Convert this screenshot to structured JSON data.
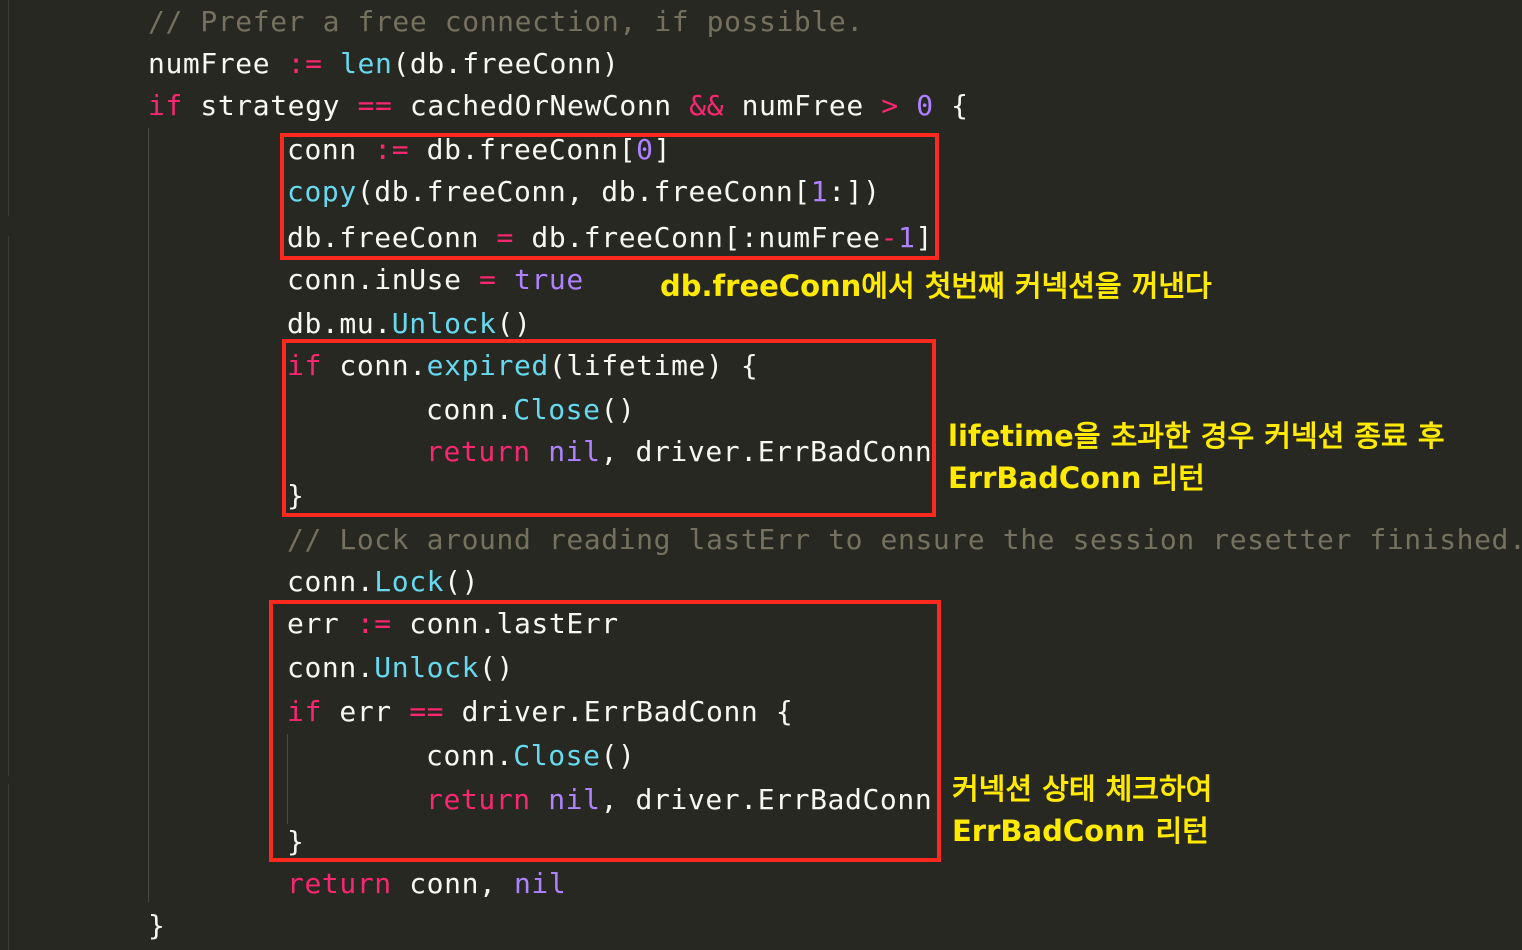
{
  "editor": {
    "lines": [
      [
        {
          "t": "// Prefer a free connection, if possible.",
          "c": "cm"
        }
      ],
      [
        {
          "t": "numFree ",
          "c": "pl"
        },
        {
          "t": ":=",
          "c": "op"
        },
        {
          "t": " ",
          "c": "pl"
        },
        {
          "t": "len",
          "c": "fn"
        },
        {
          "t": "(db.freeConn)",
          "c": "pl"
        }
      ],
      [
        {
          "t": "if",
          "c": "kw"
        },
        {
          "t": " strategy ",
          "c": "pl"
        },
        {
          "t": "==",
          "c": "op"
        },
        {
          "t": " cachedOrNewConn ",
          "c": "pl"
        },
        {
          "t": "&&",
          "c": "op"
        },
        {
          "t": " numFree ",
          "c": "pl"
        },
        {
          "t": ">",
          "c": "op"
        },
        {
          "t": " ",
          "c": "pl"
        },
        {
          "t": "0",
          "c": "nm"
        },
        {
          "t": " {",
          "c": "pl"
        }
      ],
      [
        {
          "t": "conn ",
          "c": "pl"
        },
        {
          "t": ":=",
          "c": "op"
        },
        {
          "t": " db.freeConn[",
          "c": "pl"
        },
        {
          "t": "0",
          "c": "nm"
        },
        {
          "t": "]",
          "c": "pl"
        }
      ],
      [
        {
          "t": "copy",
          "c": "fn"
        },
        {
          "t": "(db.freeConn, db.freeConn[",
          "c": "pl"
        },
        {
          "t": "1",
          "c": "nm"
        },
        {
          "t": ":])",
          "c": "pl"
        }
      ],
      [
        {
          "t": "db.freeConn ",
          "c": "pl"
        },
        {
          "t": "=",
          "c": "op"
        },
        {
          "t": " db.freeConn[:numFree",
          "c": "pl"
        },
        {
          "t": "-",
          "c": "op"
        },
        {
          "t": "1",
          "c": "nm"
        },
        {
          "t": "]",
          "c": "pl"
        }
      ],
      [
        {
          "t": "conn.inUse ",
          "c": "pl"
        },
        {
          "t": "=",
          "c": "op"
        },
        {
          "t": " ",
          "c": "pl"
        },
        {
          "t": "true",
          "c": "nm"
        }
      ],
      [
        {
          "t": "db.mu.",
          "c": "pl"
        },
        {
          "t": "Unlock",
          "c": "fn"
        },
        {
          "t": "()",
          "c": "pl"
        }
      ],
      [
        {
          "t": "if",
          "c": "kw"
        },
        {
          "t": " conn.",
          "c": "pl"
        },
        {
          "t": "expired",
          "c": "fn"
        },
        {
          "t": "(lifetime) {",
          "c": "pl"
        }
      ],
      [
        {
          "t": "conn.",
          "c": "pl"
        },
        {
          "t": "Close",
          "c": "fn"
        },
        {
          "t": "()",
          "c": "pl"
        }
      ],
      [
        {
          "t": "return",
          "c": "kw"
        },
        {
          "t": " ",
          "c": "pl"
        },
        {
          "t": "nil",
          "c": "nm"
        },
        {
          "t": ", driver.ErrBadConn",
          "c": "pl"
        }
      ],
      [
        {
          "t": "}",
          "c": "pl"
        }
      ],
      [
        {
          "t": "// Lock around reading lastErr to ensure the session resetter finished.",
          "c": "cm"
        }
      ],
      [
        {
          "t": "conn.",
          "c": "pl"
        },
        {
          "t": "Lock",
          "c": "fn"
        },
        {
          "t": "()",
          "c": "pl"
        }
      ],
      [
        {
          "t": "err ",
          "c": "pl"
        },
        {
          "t": ":=",
          "c": "op"
        },
        {
          "t": " conn.lastErr",
          "c": "pl"
        }
      ],
      [
        {
          "t": "conn.",
          "c": "pl"
        },
        {
          "t": "Unlock",
          "c": "fn"
        },
        {
          "t": "()",
          "c": "pl"
        }
      ],
      [
        {
          "t": "if",
          "c": "kw"
        },
        {
          "t": " err ",
          "c": "pl"
        },
        {
          "t": "==",
          "c": "op"
        },
        {
          "t": " driver.ErrBadConn {",
          "c": "pl"
        }
      ],
      [
        {
          "t": "conn.",
          "c": "pl"
        },
        {
          "t": "Close",
          "c": "fn"
        },
        {
          "t": "()",
          "c": "pl"
        }
      ],
      [
        {
          "t": "return",
          "c": "kw"
        },
        {
          "t": " ",
          "c": "pl"
        },
        {
          "t": "nil",
          "c": "nm"
        },
        {
          "t": ", driver.ErrBadConn",
          "c": "pl"
        }
      ],
      [
        {
          "t": "}",
          "c": "pl"
        }
      ],
      [
        {
          "t": "return",
          "c": "kw"
        },
        {
          "t": " conn, ",
          "c": "pl"
        },
        {
          "t": "nil",
          "c": "nm"
        }
      ],
      [
        {
          "t": "}",
          "c": "pl"
        }
      ]
    ]
  },
  "annotations": {
    "note1": "db.freeConn에서 첫번째 커넥션을 꺼낸다",
    "note2_line1": "lifetime을 초과한 경우 커넥션 종료 후",
    "note2_line2": "ErrBadConn 리턴",
    "note3_line1": "커넥션 상태 체크하여",
    "note3_line2": "ErrBadConn 리턴"
  },
  "colors": {
    "background": "#272822",
    "comment": "#75715e",
    "keyword": "#f92672",
    "function": "#66d9ef",
    "number": "#ae81ff",
    "plain": "#f8f8f2",
    "highlight_box": "#ff2a1f",
    "annotation_text": "#ffea00"
  }
}
